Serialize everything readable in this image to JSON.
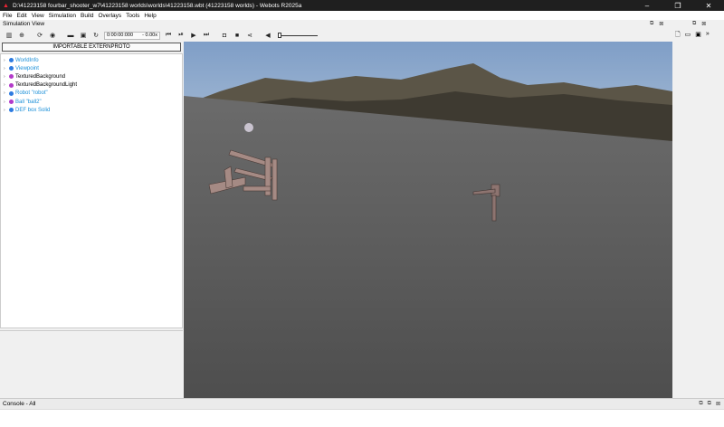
{
  "window": {
    "title": "D:\\41223158 fourbar_shooter_w7\\41223158 worlds\\worlds\\41223158.wbt (41223158 worlds) - Webots R2025a",
    "controls": [
      "–",
      "❐",
      "✕"
    ]
  },
  "menu": [
    "File",
    "Edit",
    "View",
    "Simulation",
    "Build",
    "Overlays",
    "Tools",
    "Help"
  ],
  "simulation_view_label": "Simulation View",
  "toolbar": {
    "time": "0:00:00:000",
    "speed": "- 0.00x"
  },
  "scene_tree": {
    "extern_button": "IMPORTABLE EXTERNPROTO",
    "items": [
      {
        "label": "WorldInfo",
        "color": "#1a8fd8",
        "dot": "#2d7be0"
      },
      {
        "label": "Viewpoint",
        "color": "#1a8fd8",
        "dot": "#2d7be0"
      },
      {
        "label": "TexturedBackground",
        "color": "#000000",
        "dot": "#b23ac9"
      },
      {
        "label": "TexturedBackgroundLight",
        "color": "#000000",
        "dot": "#b23ac9"
      },
      {
        "label": "Robot \"robot\"",
        "color": "#1a8fd8",
        "dot": "#2d7be0"
      },
      {
        "label": "Ball \"ball2\"",
        "color": "#1a8fd8",
        "dot": "#b23ac9"
      },
      {
        "label": "DEF box Solid",
        "color": "#1a8fd8",
        "dot": "#2d7be0"
      }
    ]
  },
  "console": {
    "label": "Console - All"
  }
}
